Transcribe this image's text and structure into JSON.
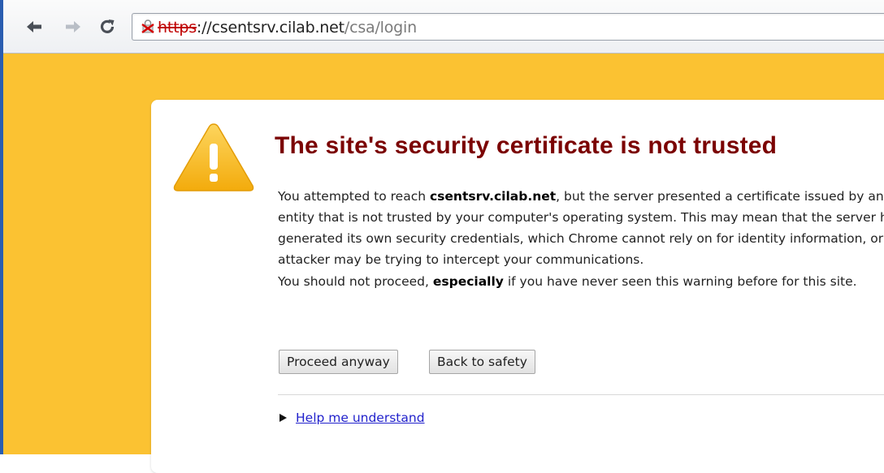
{
  "browser": {
    "back_icon": "arrow-left-icon",
    "forward_icon": "arrow-right-icon",
    "reload_icon": "reload-icon",
    "security_icon": "broken-lock-icon",
    "url": {
      "scheme": "https",
      "separator": "://",
      "host": "csentsrv.cilab.net",
      "path": "/csa/login"
    }
  },
  "interstitial": {
    "background_color": "#fbc232",
    "title_color": "#7b0303",
    "warning_icon": "warning-triangle-icon",
    "title": "The site's security certificate is not trusted",
    "para1": {
      "prefix": "You attempted to reach ",
      "host": "csentsrv.cilab.net",
      "suffix": ", but the server presented a certificate issued by an entity that is not trusted by your computer's operating system. This may mean that the server has generated its own security credentials, which Chrome cannot rely on for identity information, or an attacker may be trying to intercept your communications."
    },
    "para2": {
      "prefix": "You should not proceed, ",
      "emphasis": "especially",
      "suffix": " if you have never seen this warning before for this site."
    },
    "proceed_label": "Proceed anyway",
    "back_label": "Back to safety",
    "help_icon": "disclosure-triangle-icon",
    "help_label": "Help me understand"
  }
}
